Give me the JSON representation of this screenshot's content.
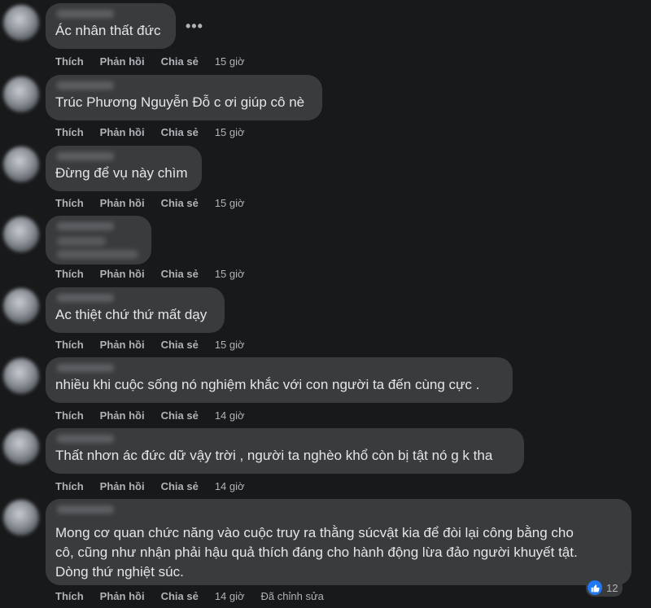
{
  "actions": {
    "like": "Thích",
    "reply": "Phản hồi",
    "share": "Chia sẻ"
  },
  "comments": [
    {
      "text": "Ác nhân thất đức",
      "time": "15 giờ"
    },
    {
      "text": "Trúc Phương Nguyễn Đỗ c ơi giúp cô nè",
      "time": "15 giờ"
    },
    {
      "text": "Đừng để vụ này chìm",
      "time": "15 giờ"
    },
    {
      "text": "",
      "time": "15 giờ"
    },
    {
      "text": "Ac thiệt chứ thứ mất dạy",
      "time": "15 giờ"
    },
    {
      "text": "nhiều khi cuộc sống nó nghiệm khắc với con người ta đến cùng cực .",
      "time": "14 giờ"
    },
    {
      "text": "Thất nhơn ác đức dữ vậy trời , người ta nghèo khổ còn bị tật nó g k tha",
      "time": "14 giờ"
    },
    {
      "text": "Mong cơ quan chức năng vào cuộc truy ra thằng súcvật kia để đòi lại công bằng cho\ncô, cũng như nhận phải hậu quả thích đáng cho hành động lừa đảo người khuyết tật.\nDòng thứ nghiệt súc.",
      "time": "14 giờ",
      "edited": "Đã chỉnh sửa",
      "reaction_count": "12",
      "reaction_icon": "like-icon"
    }
  ],
  "more_icon": "more-options-icon"
}
